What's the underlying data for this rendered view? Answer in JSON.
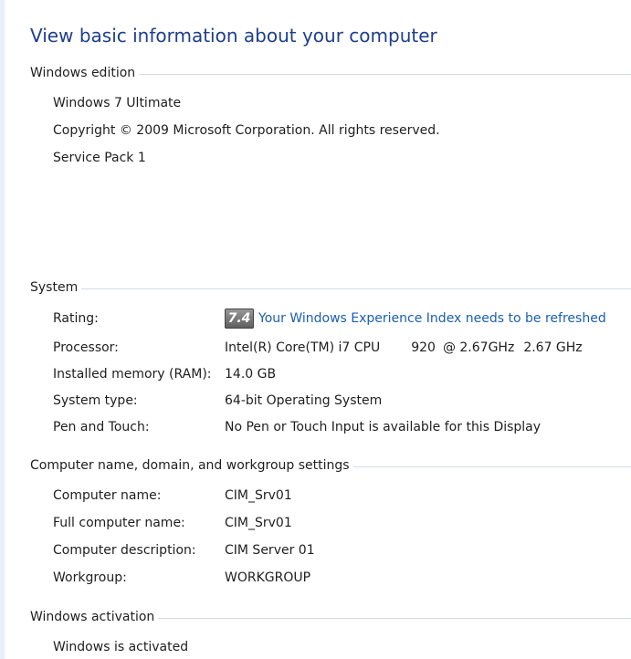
{
  "page": {
    "title": "View basic information about your computer"
  },
  "edition": {
    "heading": "Windows edition",
    "name": "Windows 7 Ultimate",
    "copyright": "Copyright © 2009 Microsoft Corporation.  All rights reserved.",
    "service_pack": "Service Pack 1"
  },
  "system": {
    "heading": "System",
    "rating_label": "Rating:",
    "rating_score": "7.4",
    "rating_link": "Your Windows Experience Index needs to be refreshed",
    "processor_label": "Processor:",
    "processor_name": "Intel(R) Core(TM) i7 CPU",
    "processor_model": "920",
    "processor_clock": "@ 2.67GHz",
    "processor_speed": "2.67 GHz",
    "memory_label": "Installed memory (RAM):",
    "memory_value": "14.0 GB",
    "type_label": "System type:",
    "type_value": "64-bit Operating System",
    "pen_label": "Pen and Touch:",
    "pen_value": "No Pen or Touch Input is available for this Display"
  },
  "computer": {
    "heading": "Computer name, domain, and workgroup settings",
    "name_label": "Computer name:",
    "name_value": "CIM_Srv01",
    "full_label": "Full computer name:",
    "full_value": "CIM_Srv01",
    "desc_label": "Computer description:",
    "desc_value": "CIM Server 01",
    "workgroup_label": "Workgroup:",
    "workgroup_value": "WORKGROUP"
  },
  "activation": {
    "heading": "Windows activation",
    "status": "Windows is activated"
  }
}
